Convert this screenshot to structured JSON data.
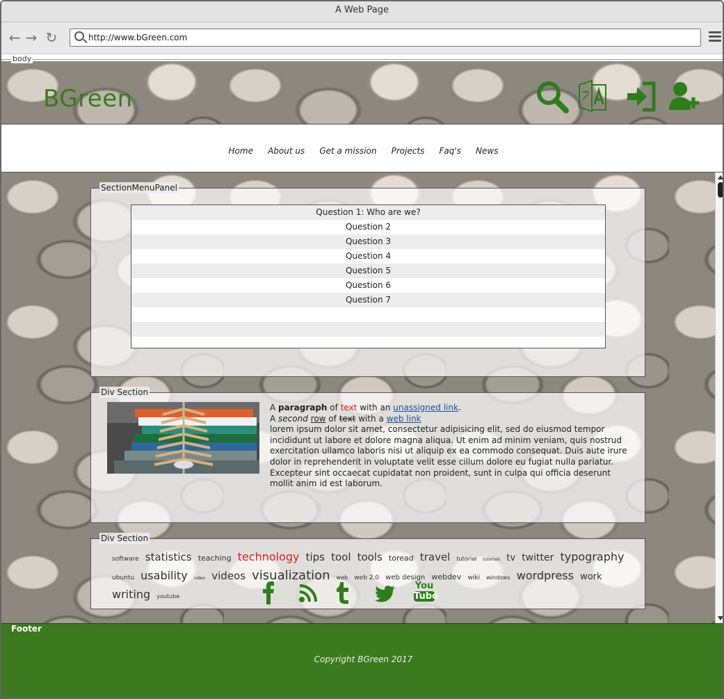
{
  "browser": {
    "window_title": "A Web Page",
    "url": "http://www.bGreen.com",
    "body_label": "body"
  },
  "header": {
    "logo": "BGreen",
    "icons": [
      "search-icon",
      "translate-icon",
      "login-icon",
      "add-user-icon"
    ]
  },
  "nav": {
    "items": [
      "Home",
      "About us",
      "Get a mission",
      "Projects",
      "Faq's",
      "News"
    ]
  },
  "section_menu": {
    "label": "SectionMenuPanel",
    "questions": [
      "Question 1: Who are we?",
      "Question 2",
      "Question 3",
      "Question 4",
      "Question 5",
      "Question 6",
      "Question 7",
      "",
      "",
      ""
    ]
  },
  "div_section_1": {
    "label": "Div Section",
    "line1": {
      "a": "A ",
      "b": "paragraph",
      "c": " of ",
      "d": "text",
      "e": " with an ",
      "f": "unassigned link",
      "g": "."
    },
    "line2": {
      "a": "A ",
      "b": "second",
      "c": " ",
      "d": "row",
      "e": " of ",
      "f": "text",
      "g": " with a ",
      "h": "web link"
    },
    "lorem": "lorem ipsum dolor sit amet, consectetur adipisicing elit, sed do eiusmod tempor incididunt ut labore et dolore magna aliqua. Ut enim ad minim veniam, quis nostrud exercitation ullamco laboris nisi ut aliquip ex ea commodo consequat. Duis aute irure dolor in reprehenderit in voluptate velit esse cillum dolore eu fugiat nulla pariatur. Excepteur sint occaecat cupidatat non proident, sunt in culpa qui officia deserunt mollit anim id est laborum."
  },
  "div_section_2": {
    "label": "Div Section",
    "tags": [
      {
        "t": "software",
        "s": 9
      },
      {
        "t": "statistics",
        "s": 15
      },
      {
        "t": "teaching",
        "s": 11
      },
      {
        "t": "technology",
        "s": 16,
        "c": "#e02020"
      },
      {
        "t": "tips",
        "s": 15
      },
      {
        "t": "tool",
        "s": 15
      },
      {
        "t": "tools",
        "s": 15
      },
      {
        "t": "toread",
        "s": 11
      },
      {
        "t": "travel",
        "s": 15
      },
      {
        "t": "tutorial",
        "s": 8
      },
      {
        "t": "tutorials",
        "s": 6
      },
      {
        "t": "tv",
        "s": 13
      },
      {
        "t": "twitter",
        "s": 14
      },
      {
        "t": "typography",
        "s": 16
      },
      {
        "t": "ubuntu",
        "s": 9
      },
      {
        "t": "usability",
        "s": 16
      },
      {
        "t": "video",
        "s": 6
      },
      {
        "t": "videos",
        "s": 15
      },
      {
        "t": "visualization",
        "s": 18
      },
      {
        "t": "web",
        "s": 8
      },
      {
        "t": "web 2.0",
        "s": 9
      },
      {
        "t": "web design",
        "s": 10
      },
      {
        "t": "webdev",
        "s": 11
      },
      {
        "t": "wiki",
        "s": 9
      },
      {
        "t": "windows",
        "s": 8
      },
      {
        "t": "wordpress",
        "s": 16
      },
      {
        "t": "work",
        "s": 13
      },
      {
        "t": "writing",
        "s": 16
      },
      {
        "t": "youtube",
        "s": 8
      }
    ],
    "social_icons": [
      "facebook-icon",
      "rss-icon",
      "tumblr-icon",
      "twitter-icon",
      "youtube-icon"
    ],
    "youtube_text": {
      "top": "You",
      "bottom": "Tube"
    }
  },
  "footer": {
    "label": "Footer",
    "copyright": "Copyright BGreen 2017"
  },
  "colors": {
    "brand_green": "#3b7a1e",
    "icon_green": "#2e7d1a",
    "accent_red": "#e02020",
    "link_blue": "#1d4e9c"
  }
}
